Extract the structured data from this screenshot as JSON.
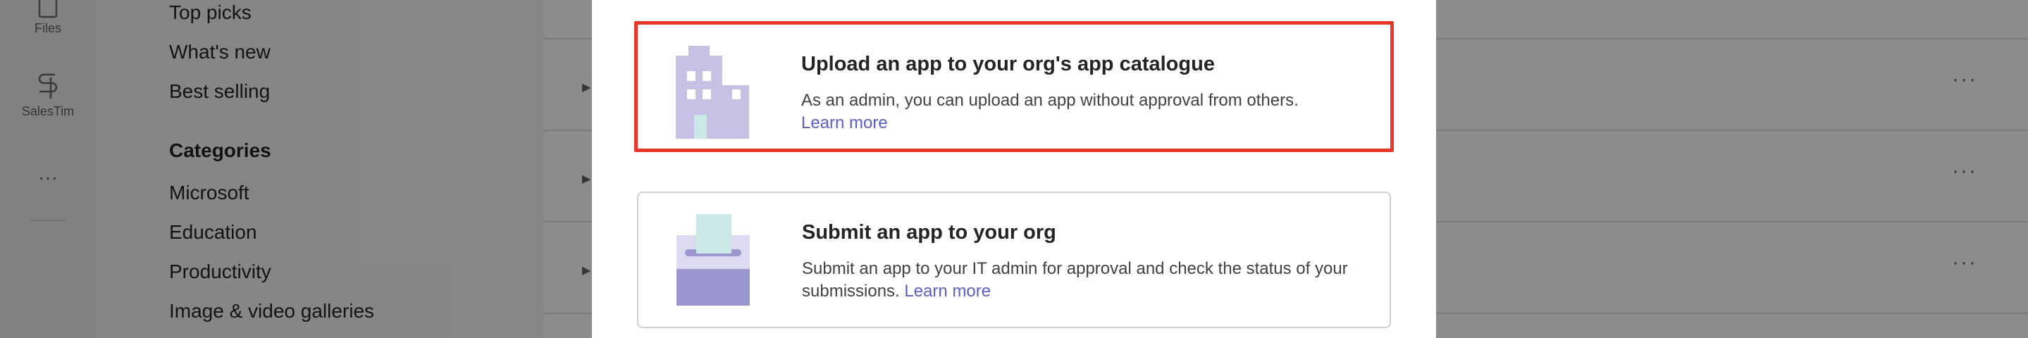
{
  "rail": {
    "files_label": "Files",
    "salestim_label": "SalesTim",
    "more_label": "···"
  },
  "store_nav": {
    "top_picks": "Top picks",
    "whats_new": "What's new",
    "best_selling": "Best selling",
    "categories_heading": "Categories",
    "categories": [
      "Microsoft",
      "Education",
      "Productivity",
      "Image & video galleries"
    ]
  },
  "main": {
    "more_glyph": "···",
    "caret_glyph": "▶"
  },
  "dialog": {
    "upload_card": {
      "title": "Upload an app to your org's app catalogue",
      "description": "As an admin, you can upload an app without approval from others.",
      "link": "Learn more",
      "icon": "building-icon"
    },
    "submit_card": {
      "title": "Submit an app to your org",
      "description": "Submit an app to your IT admin for approval and check the status of your submissions.",
      "link": "Learn more",
      "icon": "submit-box-icon"
    }
  },
  "colors": {
    "highlight_border": "#e8372b",
    "link": "#5b5fc7",
    "illustration_purple": "#c5c2e6",
    "illustration_dark_purple": "#9896cc",
    "illustration_teal": "#c9e8e6"
  }
}
